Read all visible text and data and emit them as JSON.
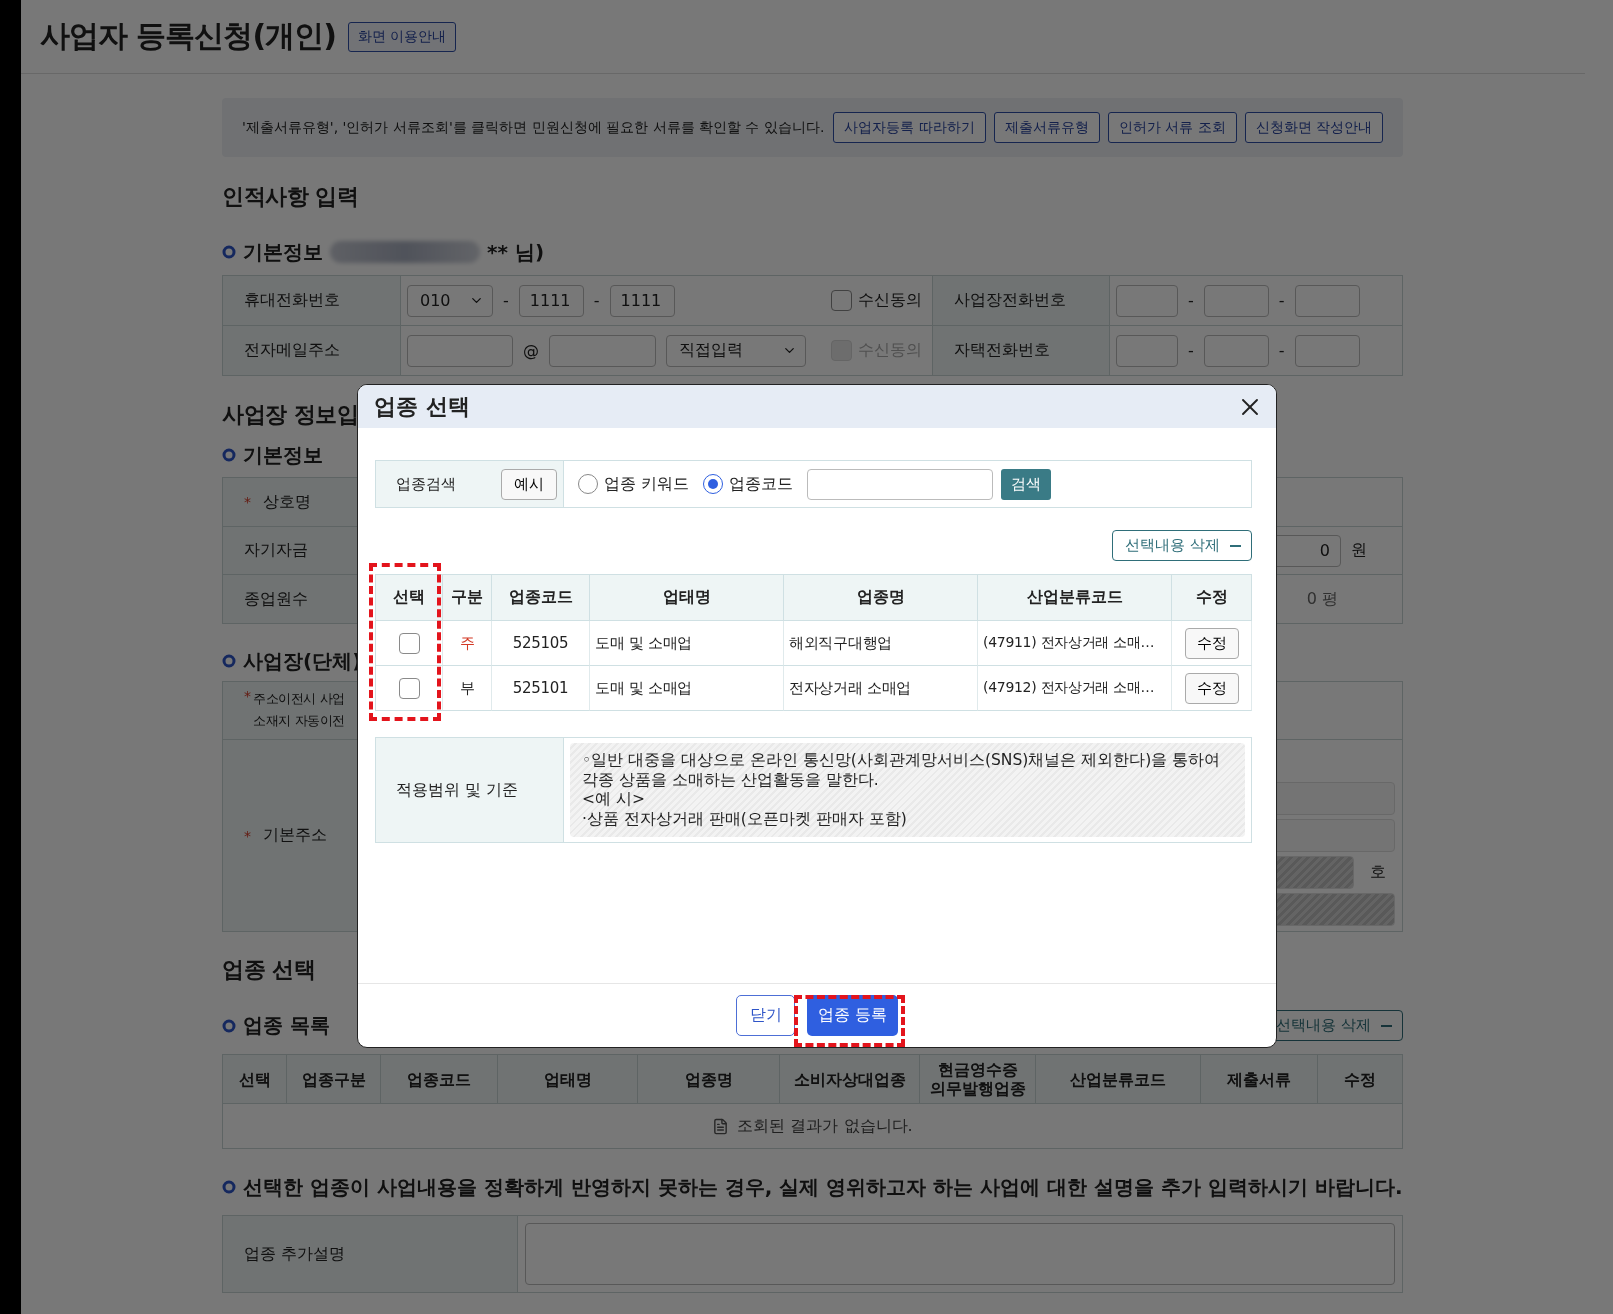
{
  "page": {
    "title": "사업자 등록신청(개인)",
    "guide_button": "화면 이용안내"
  },
  "notice_box": {
    "text": "'제출서류유형', '인허가 서류조회'를 클릭하면 민원신청에 필요한 서류를 확인할 수 있습니다.",
    "buttons": [
      "사업자등록 따라하기",
      "제출서류유형",
      "인허가 서류 조회",
      "신청화면 작성안내"
    ]
  },
  "personal": {
    "heading": "인적사항 입력",
    "subheading": "기본정보",
    "name_suffix": "** 님)",
    "mobile": {
      "label": "휴대전화번호",
      "prefix": "010",
      "middle": "1111",
      "last": "1111",
      "separators": [
        "-",
        "-"
      ],
      "consent": {
        "label": "수신동의",
        "checked": false,
        "disabled": false
      }
    },
    "email": {
      "label": "전자메일주소",
      "at": "@",
      "domain_select": "직접입력",
      "consent": {
        "label": "수신동의",
        "checked": false,
        "disabled": true
      }
    },
    "business_phone": {
      "label": "사업장전화번호",
      "separators": [
        "-",
        "-"
      ]
    },
    "home_phone": {
      "label": "자택전화번호",
      "separators": [
        "-",
        "-"
      ]
    }
  },
  "business": {
    "heading": "사업장 정보입",
    "subheading": "기본정보",
    "trade_name": {
      "mark": "*",
      "label": "상호명"
    },
    "own_funds": {
      "label": "자기자금",
      "value": "0",
      "unit": "원"
    },
    "employees": {
      "label": "종업원수",
      "area": "0 평"
    }
  },
  "site": {
    "heading": "사업장(단체)",
    "move": {
      "mark": "*",
      "lines": [
        "주소이전시 사업",
        "소재지 자동이전"
      ]
    },
    "address": {
      "mark": "*",
      "label": "기본주소"
    },
    "address_fields": [
      {
        "readonly": false
      },
      {
        "readonly": false
      },
      {
        "readonly": true,
        "unit": "호"
      },
      {
        "readonly": true
      }
    ]
  },
  "industry": {
    "heading": "업종 선택",
    "list_heading": "업종 목록",
    "delete_button": "선택내용 삭제",
    "columns": [
      "선택",
      "업종구분",
      "업종코드",
      "업태명",
      "업종명",
      "소비자상대업종",
      "현금영수증 의무발행업종",
      "산업분류코드",
      "제출서류",
      "수정"
    ],
    "empty": "조회된 결과가 없습니다."
  },
  "extra": {
    "notice": "선택한 업종이 사업내용을 정확하게 반영하지 못하는 경우, 실제 영위하고자 하는 사업에 대한 설명을 추가 입력하시기 바랍니다.",
    "label": "업종 추가설명"
  },
  "modal": {
    "title": "업종 선택",
    "search": {
      "label": "업종검색",
      "example_button": "예시",
      "options": [
        {
          "label": "업종 키워드",
          "selected": false
        },
        {
          "label": "업종코드",
          "selected": true
        }
      ],
      "button": "검색"
    },
    "delete_button": "선택내용 삭제",
    "columns": [
      "선택",
      "구분",
      "업종코드",
      "업태명",
      "업종명",
      "산업분류코드",
      "수정"
    ],
    "rows": [
      {
        "checked": false,
        "type": "주",
        "color": "#d33a26",
        "code": "525105",
        "business_type": "도매 및 소매업",
        "industry_name": "해외직구대행업",
        "classification": "(47911) 전자상거래 소매…",
        "edit_button": "수정"
      },
      {
        "checked": false,
        "type": "부",
        "color": "#222222",
        "code": "525101",
        "business_type": "도매 및 소매업",
        "industry_name": "전자상거래 소매업",
        "classification": "(47912) 전자상거래 소매…",
        "edit_button": "수정"
      }
    ],
    "scope": {
      "label": "적용범위 및 기준",
      "lines": [
        "◦일반 대중을 대상으로 온라인 통신망(사회관계망서비스(SNS)채널은 제외한다)을 통하여 각종 상품을 소매하는 산업활동을 말한다.",
        "<예 시>",
        "·상품 전자상거래 판매(오픈마켓 판매자 포함)"
      ]
    },
    "close_button": "닫기",
    "register_button": "업종 등록"
  }
}
